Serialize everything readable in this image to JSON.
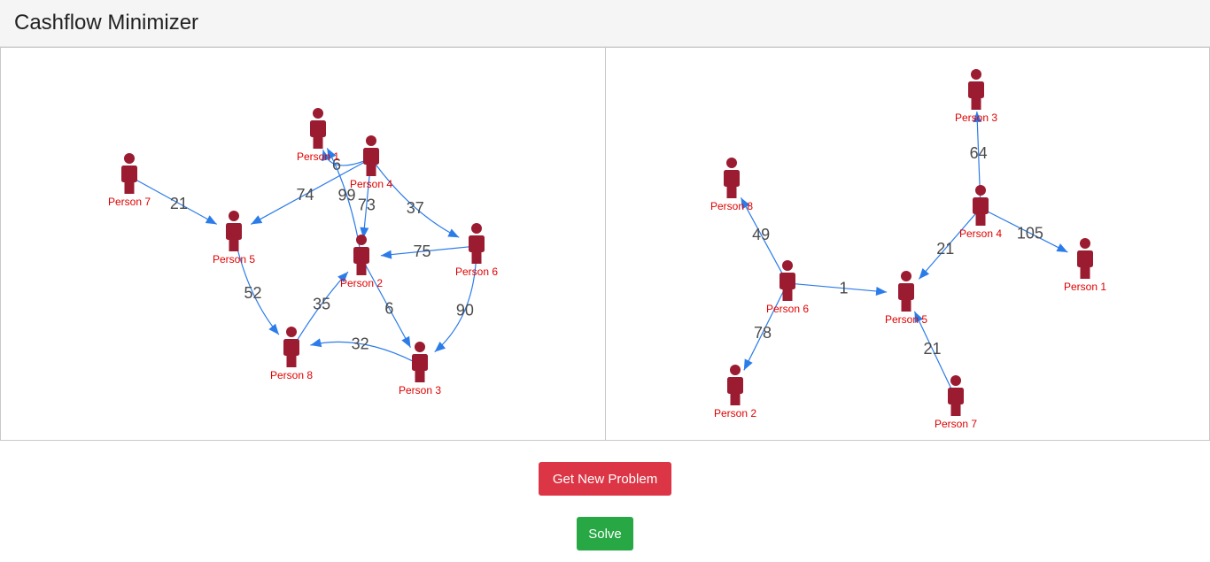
{
  "header": {
    "title": "Cashflow Minimizer"
  },
  "buttons": {
    "new_problem_label": "Get New Problem",
    "solve_label": "Solve"
  },
  "colors": {
    "person": "#9b1b30",
    "edge": "#2b7ce9",
    "node_label": "#e00000",
    "danger": "#dc3545",
    "success": "#28a745"
  },
  "problem_graph": {
    "nodes": [
      "Person 1",
      "Person 2",
      "Person 3",
      "Person 4",
      "Person 5",
      "Person 6",
      "Person 7",
      "Person 8"
    ],
    "edges": [
      {
        "from": "Person 4",
        "to": "Person 1",
        "amount": "6"
      },
      {
        "from": "Person 4",
        "to": "Person 5",
        "amount": "74"
      },
      {
        "from": "Person 4",
        "to": "Person 6",
        "amount": "37"
      },
      {
        "from": "Person 4",
        "to": "Person 2",
        "amount": "73"
      },
      {
        "from": "Person 2",
        "to": "Person 1",
        "amount": "99"
      },
      {
        "from": "Person 7",
        "to": "Person 5",
        "amount": "21"
      },
      {
        "from": "Person 6",
        "to": "Person 2",
        "amount": "75"
      },
      {
        "from": "Person 5",
        "to": "Person 8",
        "amount": "52"
      },
      {
        "from": "Person 8",
        "to": "Person 2",
        "amount": "35"
      },
      {
        "from": "Person 2",
        "to": "Person 3",
        "amount": "6"
      },
      {
        "from": "Person 6",
        "to": "Person 3",
        "amount": "90"
      },
      {
        "from": "Person 3",
        "to": "Person 8",
        "amount": "32"
      }
    ]
  },
  "solution_graph": {
    "nodes": [
      "Person 1",
      "Person 2",
      "Person 3",
      "Person 4",
      "Person 5",
      "Person 6",
      "Person 7",
      "Person 8"
    ],
    "edges": [
      {
        "from": "Person 4",
        "to": "Person 3",
        "amount": "64"
      },
      {
        "from": "Person 6",
        "to": "Person 8",
        "amount": "49"
      },
      {
        "from": "Person 4",
        "to": "Person 5",
        "amount": "21"
      },
      {
        "from": "Person 4",
        "to": "Person 1",
        "amount": "105"
      },
      {
        "from": "Person 6",
        "to": "Person 5",
        "amount": "1"
      },
      {
        "from": "Person 6",
        "to": "Person 2",
        "amount": "78"
      },
      {
        "from": "Person 7",
        "to": "Person 5",
        "amount": "21"
      }
    ]
  }
}
